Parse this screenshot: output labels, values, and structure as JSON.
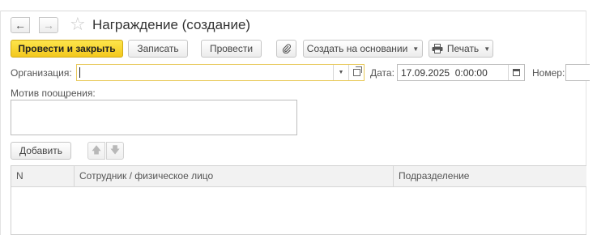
{
  "header": {
    "title": "Награждение (создание)",
    "back_icon": "arrow-left-icon",
    "forward_icon": "arrow-right-icon",
    "favorite_icon": "star-icon"
  },
  "toolbar": {
    "post_and_close": "Провести и закрыть",
    "save": "Записать",
    "post": "Провести",
    "attach_icon": "paperclip-icon",
    "create_based_on": "Создать на основании",
    "print": "Печать"
  },
  "form": {
    "organization_label": "Организация:",
    "organization_value": "",
    "date_label": "Дата:",
    "date_value": "17.09.2025  0:00:00",
    "number_label": "Номер:",
    "number_value": "",
    "motive_label": "Мотив поощрения:",
    "motive_value": ""
  },
  "table_toolbar": {
    "add": "Добавить",
    "up_icon": "arrow-up-icon",
    "down_icon": "arrow-down-icon"
  },
  "table": {
    "columns": [
      "N",
      "Сотрудник / физическое лицо",
      "Подразделение"
    ],
    "rows": []
  },
  "colors": {
    "primary_button": "#f7d22e",
    "focus_border": "#e8c95a"
  }
}
